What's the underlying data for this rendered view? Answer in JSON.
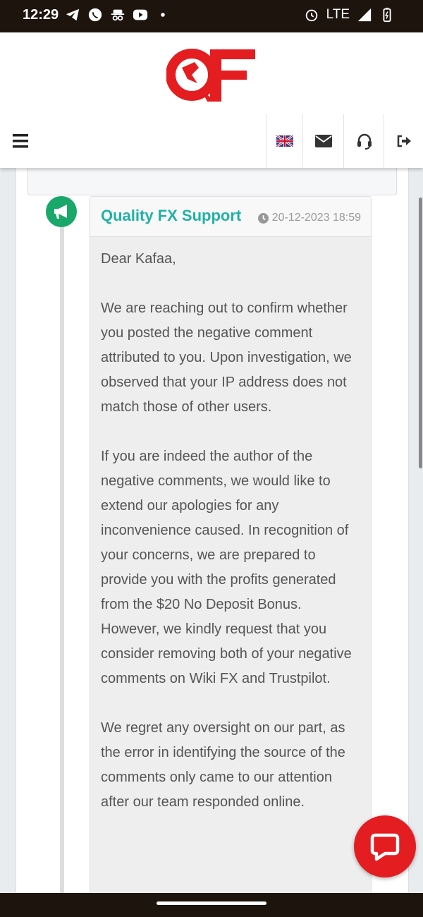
{
  "status_bar": {
    "time": "12:29",
    "network": "LTE"
  },
  "colors": {
    "accent_teal": "#21b2a6",
    "badge_green": "#1aa76a",
    "brand_red": "#e41d21"
  },
  "icons": [
    "telegram-icon",
    "whatsapp-icon",
    "incognito-icon",
    "youtube-icon",
    "alarm-icon",
    "signal-icon",
    "battery-icon",
    "menu-icon",
    "uk-flag-icon",
    "envelope-icon",
    "headset-icon",
    "sign-out-icon",
    "megaphone-icon",
    "clock-icon",
    "chat-icon"
  ],
  "message": {
    "author": "Quality FX Support",
    "timestamp": "20-12-2023 18:59",
    "paragraphs": [
      "Dear Kafaa,",
      "We are reaching out to confirm whether you posted the negative comment attributed to you. Upon investigation, we observed that your IP address does not match those of other users.",
      "If you are indeed the author of the negative comments, we would like to extend our apologies for any inconvenience caused. In recognition of your concerns, we are prepared to provide you with the profits generated from the $20 No Deposit Bonus. However, we kindly request that you consider removing both of your negative comments on Wiki FX and Trustpilot.",
      "We regret any oversight on our part, as the error in identifying the source of the comments only came to our attention after our team responded online."
    ]
  }
}
